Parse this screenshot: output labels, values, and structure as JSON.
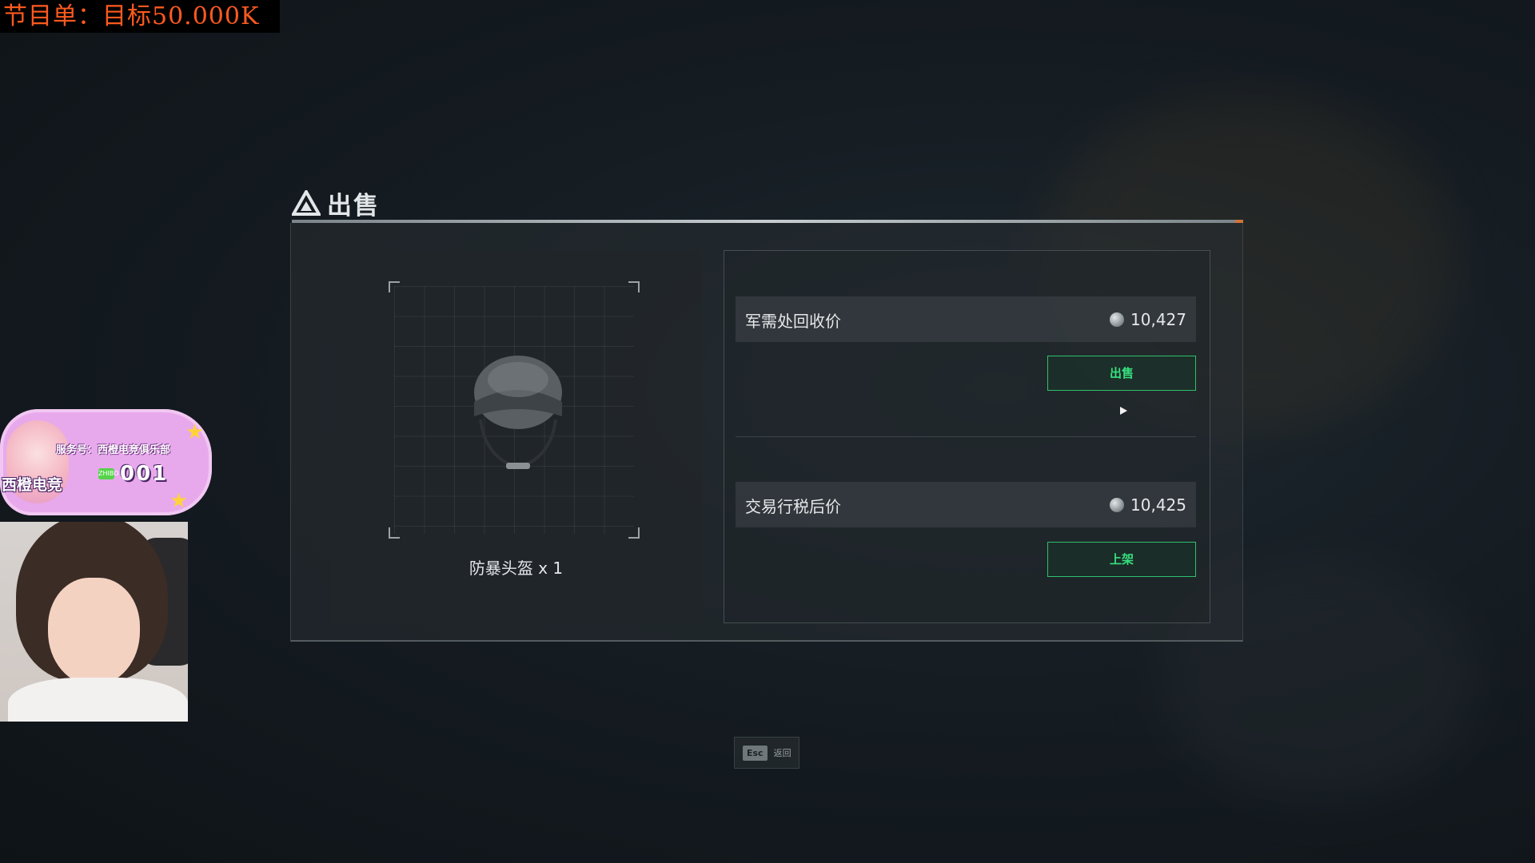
{
  "overlay": {
    "banner_text": "节目单：目标50.000K",
    "badge_service": "服务号：西橙电竞俱乐部",
    "badge_club": "西橙电竞",
    "badge_icon_text": "ZHIBO",
    "badge_number": "001"
  },
  "dialog": {
    "title": "出售",
    "item_name": "防暴头盔 x 1",
    "rows": [
      {
        "label": "军需处回收价",
        "value": "10,427",
        "button": "出售"
      },
      {
        "label": "交易行税后价",
        "value": "10,425",
        "button": "上架"
      }
    ]
  },
  "footer": {
    "esc_key": "Esc",
    "esc_label": "返回"
  },
  "colors": {
    "accent_green": "#36e07e",
    "banner_text": "#ff5a1f",
    "title_line_edge": "#d0733a"
  },
  "icons": [
    "title-triangle-icon",
    "silver-coin-icon",
    "mouse-cursor-icon"
  ]
}
